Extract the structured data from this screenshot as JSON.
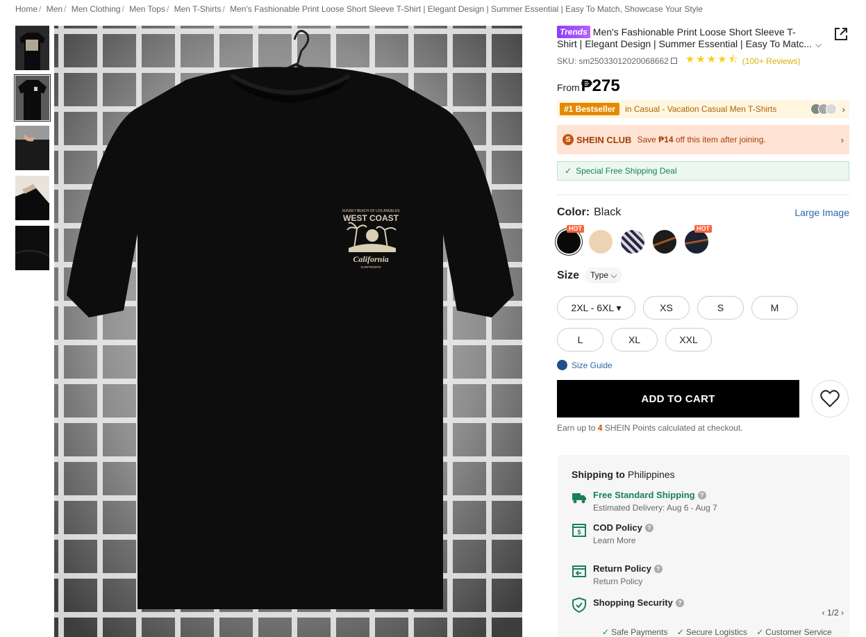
{
  "breadcrumb": [
    {
      "label": "Home"
    },
    {
      "label": "Men"
    },
    {
      "label": "Men Clothing"
    },
    {
      "label": "Men Tops"
    },
    {
      "label": "Men T-Shirts"
    },
    {
      "label": "Men's Fashionable Print Loose Short Sleeve T-Shirt | Elegant Design | Summer Essential | Easy To Match, Showcase Your Style"
    }
  ],
  "product": {
    "badge": "Trends",
    "title": "Men's Fashionable Print Loose Short Sleeve T-Shirt | Elegant Design | Summer Essential | Easy To Matc...",
    "sku": "SKU: sm25033012020068662",
    "rating": 4.5,
    "reviews": "(100+ Reviews)",
    "price_prefix": "From",
    "price": "₱275",
    "print_text": {
      "top": "SUNSET BEACH OF LOS ANGELES",
      "main": "WEST COAST",
      "script": "California",
      "bottom": "SURFRIDERS"
    }
  },
  "bestseller": {
    "tag": "#1 Bestseller",
    "category": "in Casual - Vacation Casual Men T-Shirts"
  },
  "club": {
    "logo": "S",
    "name": "SHEIN CLUB",
    "text_pre": "Save",
    "amount": "₱14",
    "text_post": "off this item after joining."
  },
  "shipping_deal": "Special Free Shipping Deal",
  "color": {
    "label": "Color:",
    "value": "Black",
    "large_image": "Large Image",
    "swatches": [
      {
        "name": "Black",
        "color": "#0a0a0a",
        "hot": "HOT",
        "selected": true
      },
      {
        "name": "Apricot",
        "color": "#ecd4b3",
        "hot": "",
        "selected": false
      },
      {
        "name": "Zebra",
        "color": "#c8c6d6",
        "hot": "",
        "selected": false
      },
      {
        "name": "Black Orange",
        "color": "#1c1c1c",
        "hot": "",
        "selected": false
      },
      {
        "name": "Navy Orange",
        "color": "#1b2233",
        "hot": "HOT",
        "selected": false
      }
    ]
  },
  "size": {
    "label": "Size",
    "type_label": "Type",
    "options": [
      "2XL - 6XL ▾",
      "XS",
      "S",
      "M",
      "L",
      "XL",
      "XXL"
    ],
    "guide": "Size Guide"
  },
  "cart": {
    "add_label": "ADD TO CART",
    "points_pre": "Earn up to",
    "points": "4",
    "points_post": "SHEIN Points calculated at checkout."
  },
  "shipping": {
    "head_bold": "Shipping to",
    "country": "Philippines",
    "items": [
      {
        "title": "Free Standard Shipping",
        "sub": "Estimated Delivery: Aug 6 - Aug 7"
      },
      {
        "title": "COD Policy",
        "sub": "Learn More"
      },
      {
        "title": "Return Policy",
        "sub": "Return Policy"
      },
      {
        "title": "Shopping Security",
        "sub": ""
      }
    ],
    "pager": "1/2",
    "security_items": [
      "Safe Payments",
      "Secure Logistics",
      "Customer Service"
    ]
  },
  "colors": {
    "accent_green": "#198055",
    "club_brown": "#a23f06",
    "link_blue": "#2d68a8",
    "star": "#facf19"
  }
}
